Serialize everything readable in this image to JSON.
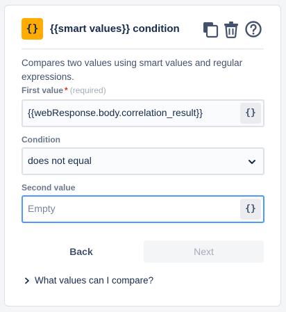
{
  "header": {
    "icon_glyph": "{}",
    "icon_color": "#ffab00",
    "title": "{{smart values}} condition",
    "copy_icon": "copy-icon",
    "delete_icon": "trash-icon",
    "help_icon": "help-icon"
  },
  "description": "Compares two values using smart values and regular expressions.",
  "first_value": {
    "label": "First value",
    "required_mark": "*",
    "required_text": "(required)",
    "value": "{{webResponse.body.correlation_result}}",
    "smart_button": "{}"
  },
  "condition": {
    "label": "Condition",
    "selected": "does not equal"
  },
  "second_value": {
    "label": "Second value",
    "placeholder": "Empty",
    "smart_button": "{}"
  },
  "actions": {
    "back_label": "Back",
    "next_label": "Next"
  },
  "expander": {
    "label": "What values can I compare?"
  },
  "colors": {
    "focus_border": "#4c9aff",
    "required": "#de350b",
    "text": "#172b4d"
  }
}
